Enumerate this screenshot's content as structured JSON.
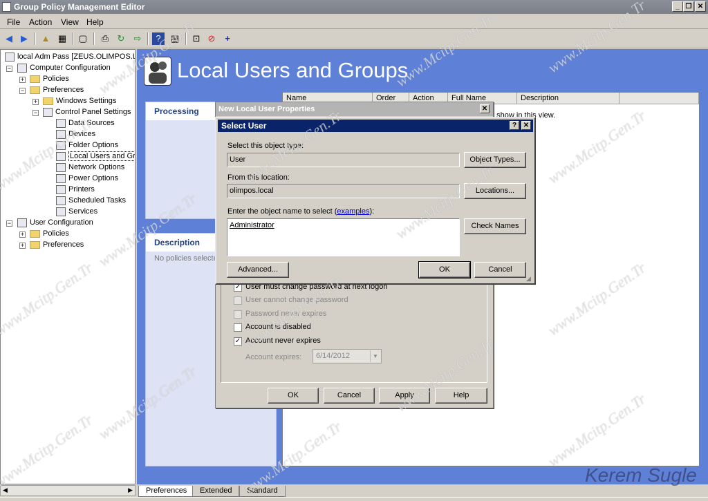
{
  "window": {
    "title": "Group Policy Management Editor"
  },
  "menu": [
    "File",
    "Action",
    "View",
    "Help"
  ],
  "tree": {
    "root": "local Adm Pass [ZEUS.OLIMPOS.LC",
    "computer_configuration": "Computer Configuration",
    "cc_policies": "Policies",
    "cc_preferences": "Preferences",
    "windows_settings": "Windows Settings",
    "control_panel_settings": "Control Panel Settings",
    "items": [
      "Data Sources",
      "Devices",
      "Folder Options",
      "Local Users and Gro",
      "Network Options",
      "Power Options",
      "Printers",
      "Scheduled Tasks",
      "Services"
    ],
    "user_configuration": "User Configuration",
    "uc_policies": "Policies",
    "uc_preferences": "Preferences"
  },
  "banner": {
    "title": "Local Users and Groups"
  },
  "processing": {
    "header": "Processing"
  },
  "description": {
    "header": "Description",
    "text": "No policies selecte"
  },
  "list": {
    "columns": [
      "Name",
      "Order",
      "Action",
      "Full Name",
      "Description"
    ],
    "empty_text": "o show in this view."
  },
  "tabs": [
    "Preferences",
    "Extended",
    "Standard"
  ],
  "props_dialog": {
    "title": "New Local User Properties",
    "options": [
      {
        "label": "User must change password at next logon",
        "checked": true,
        "disabled": false
      },
      {
        "label": "User cannot change password",
        "checked": false,
        "disabled": true
      },
      {
        "label": "Password never expires",
        "checked": false,
        "disabled": true
      },
      {
        "label": "Account is disabled",
        "checked": false,
        "disabled": false
      },
      {
        "label": "Account never expires",
        "checked": true,
        "disabled": false
      }
    ],
    "expires_label": "Account expires:",
    "expires_value": "6/14/2012",
    "buttons": {
      "ok": "OK",
      "cancel": "Cancel",
      "apply": "Apply",
      "help": "Help"
    }
  },
  "select_user": {
    "title": "Select User",
    "object_type_label": "Select this object type:",
    "object_type_value": "User",
    "object_types_button": "Object Types...",
    "location_label": "From this location:",
    "location_value": "olimpos.local",
    "locations_button": "Locations...",
    "enter_label": "Enter the object name to select (",
    "examples_link": "examples",
    "enter_label_end": "):",
    "name_value": "Administrator",
    "check_names_button": "Check Names",
    "advanced_button": "Advanced...",
    "ok_button": "OK",
    "cancel_button": "Cancel",
    "help_glyph": "?",
    "close_glyph": "✕"
  },
  "watermark": {
    "text": "www.Mcitp.Gen.Tr",
    "signature": "Kerem Sugle"
  },
  "colors": {
    "pane_blue": "#5e80d6",
    "titlebar_active": "#0a246a"
  }
}
